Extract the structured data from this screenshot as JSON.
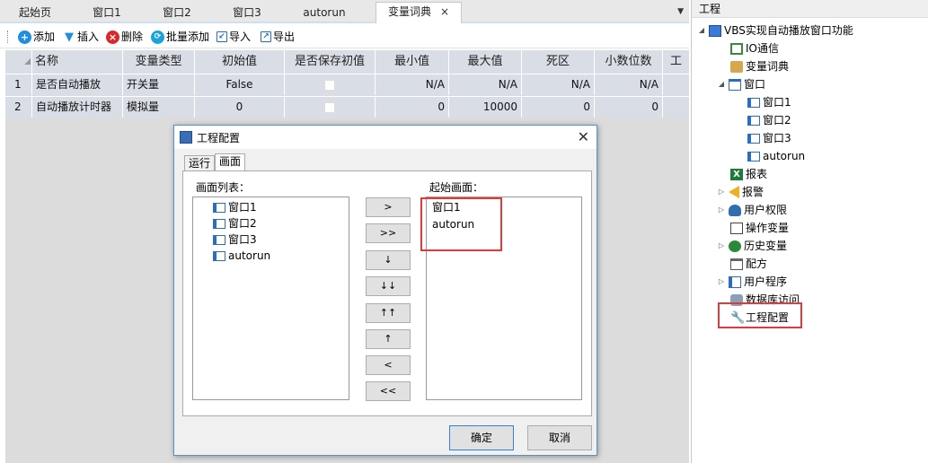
{
  "tabs": [
    {
      "label": "起始页"
    },
    {
      "label": "窗口1"
    },
    {
      "label": "窗口2"
    },
    {
      "label": "窗口3"
    },
    {
      "label": "autorun"
    },
    {
      "label": "变量词典",
      "close": "×"
    }
  ],
  "toolbar": {
    "add": "添加",
    "insert": "插入",
    "delete": "删除",
    "batch_add": "批量添加",
    "import": "导入",
    "export": "导出"
  },
  "grid": {
    "columns": [
      "名称",
      "变量类型",
      "初始值",
      "是否保存初值",
      "最小值",
      "最大值",
      "死区",
      "小数位数",
      "工"
    ],
    "rows": [
      {
        "index": "1",
        "name": "是否自动播放",
        "type": "开关量",
        "init": "False",
        "min": "N/A",
        "max": "N/A",
        "deadband": "N/A",
        "decimals": "N/A"
      },
      {
        "index": "2",
        "name": "自动播放计时器",
        "type": "模拟量",
        "init": "0",
        "min": "0",
        "max": "10000",
        "deadband": "0",
        "decimals": "0"
      }
    ]
  },
  "panel": {
    "title": "工程",
    "items": [
      {
        "label": "VBS实现自动播放窗口功能",
        "icon": "project-icon"
      },
      {
        "label": "IO通信",
        "icon": "io-icon"
      },
      {
        "label": "变量词典",
        "icon": "dictionary-icon"
      },
      {
        "label": "窗口",
        "icon": "window-folder-icon"
      },
      {
        "label": "窗口1",
        "icon": "window-icon"
      },
      {
        "label": "窗口2",
        "icon": "window-icon"
      },
      {
        "label": "窗口3",
        "icon": "window-icon"
      },
      {
        "label": "autorun",
        "icon": "window-icon"
      },
      {
        "label": "报表",
        "icon": "report-icon"
      },
      {
        "label": "报警",
        "icon": "alarm-icon"
      },
      {
        "label": "用户权限",
        "icon": "user-icon"
      },
      {
        "label": "操作变量",
        "icon": "operate-icon"
      },
      {
        "label": "历史变量",
        "icon": "history-icon"
      },
      {
        "label": "配方",
        "icon": "recipe-icon"
      },
      {
        "label": "用户程序",
        "icon": "program-icon"
      },
      {
        "label": "数据库访问",
        "icon": "database-icon"
      },
      {
        "label": "工程配置",
        "icon": "wrench-icon"
      }
    ]
  },
  "dialog": {
    "title": "工程配置",
    "close": "✕",
    "tabs": [
      "运行",
      "画面"
    ],
    "list_label": "画面列表：",
    "start_label": "起始画面：",
    "screens": [
      "窗口1",
      "窗口2",
      "窗口3",
      "autorun"
    ],
    "start_screens": [
      "窗口1",
      "autorun"
    ],
    "buttons": [
      ">",
      ">>",
      "↓",
      "↓↓",
      "↑↑",
      "↑",
      "<",
      "<<"
    ],
    "ok": "确定",
    "cancel": "取消"
  },
  "colors": {
    "highlight": "#e23a3a",
    "header_bg": "#d9dde6",
    "accent": "#1e8fe0"
  }
}
